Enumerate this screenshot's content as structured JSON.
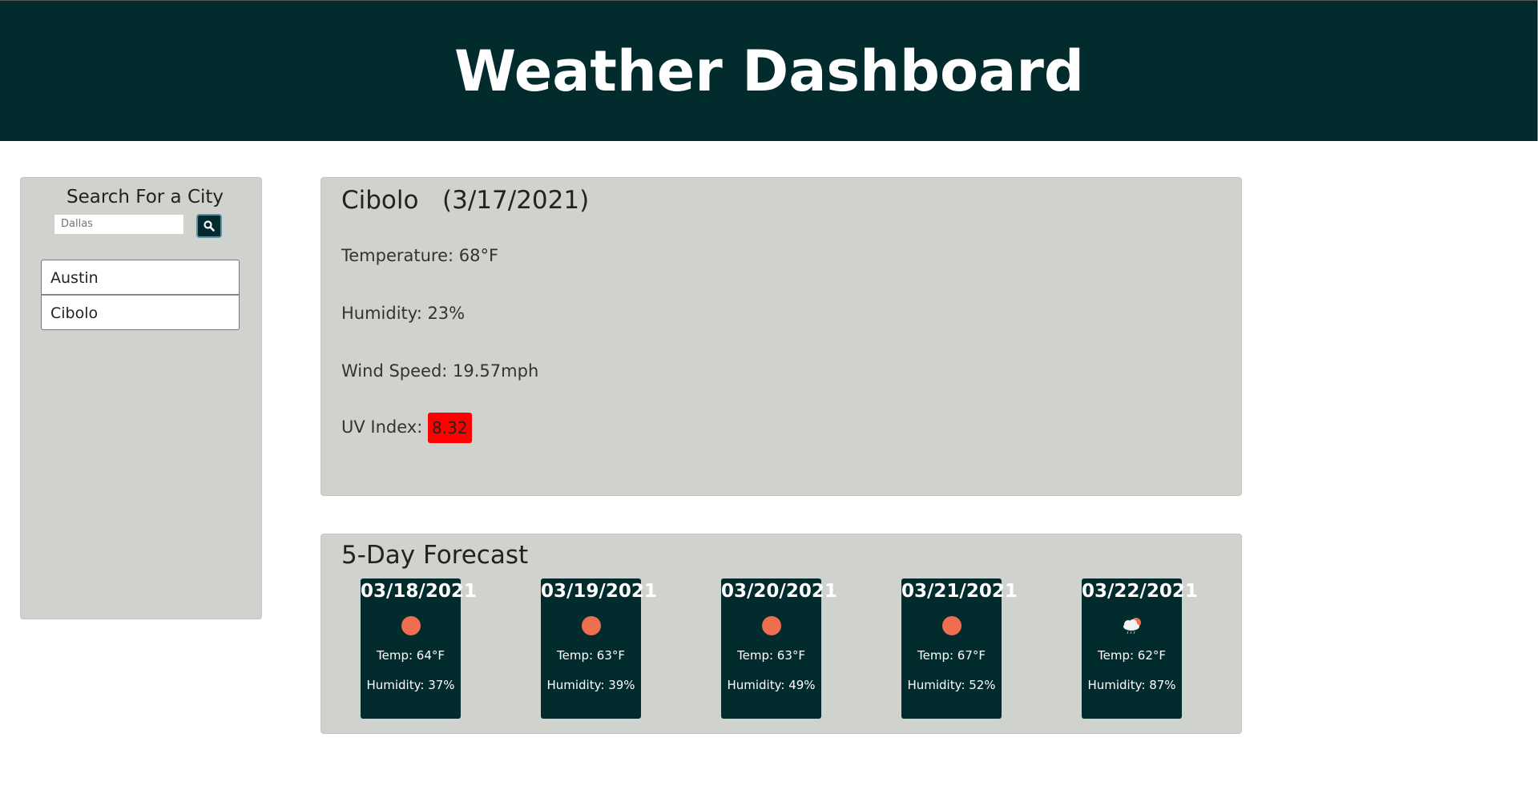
{
  "header": {
    "title": "Weather Dashboard"
  },
  "sidebar": {
    "title": "Search For a City",
    "search_placeholder": "Dallas",
    "search_button_icon": "search-icon",
    "cities": [
      "Austin",
      "Cibolo"
    ]
  },
  "current": {
    "city": "Cibolo",
    "date": "(3/17/2021)",
    "temperature": "Temperature: 68°F",
    "humidity": "Humidity: 23%",
    "wind": "Wind Speed: 19.57mph",
    "uv_label": "UV Index: ",
    "uv_value": "8.32",
    "uv_color": "#ff0000"
  },
  "forecast": {
    "title": "5-Day Forecast",
    "days": [
      {
        "date": "03/18/2021",
        "icon": "sun-icon",
        "temp": "Temp: 64°F",
        "humidity": "Humidity: 37%"
      },
      {
        "date": "03/19/2021",
        "icon": "sun-icon",
        "temp": "Temp: 63°F",
        "humidity": "Humidity: 39%"
      },
      {
        "date": "03/20/2021",
        "icon": "sun-icon",
        "temp": "Temp: 63°F",
        "humidity": "Humidity: 49%"
      },
      {
        "date": "03/21/2021",
        "icon": "sun-icon",
        "temp": "Temp: 67°F",
        "humidity": "Humidity: 52%"
      },
      {
        "date": "03/22/2021",
        "icon": "rain-cloud-sun-icon",
        "temp": "Temp: 62°F",
        "humidity": "Humidity: 87%"
      }
    ]
  },
  "colors": {
    "header_bg": "#022b2e",
    "panel_bg": "#d0d2ce",
    "sun": "#ee6e4f"
  }
}
